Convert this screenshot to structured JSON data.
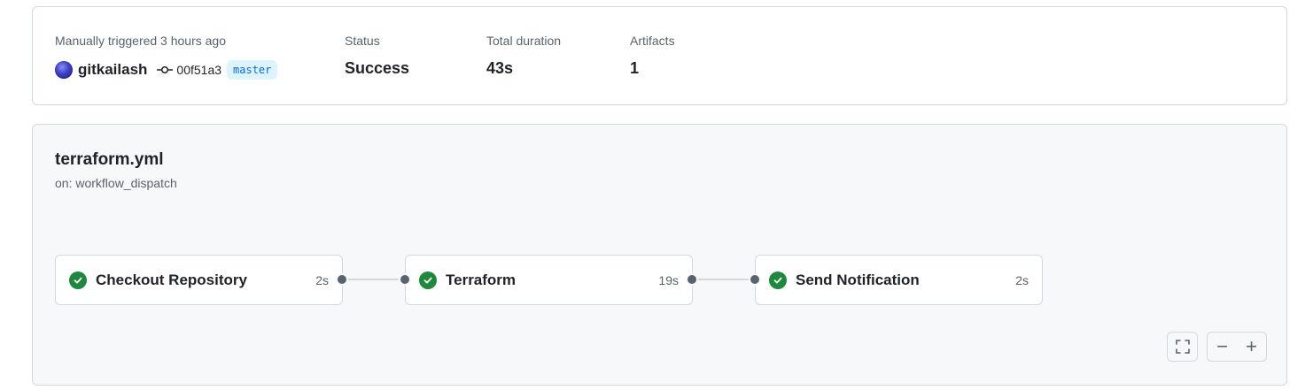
{
  "summary": {
    "trigger_label": "Manually triggered 3 hours ago",
    "actor": "gitkailash",
    "commit_sha": "00f51a3",
    "branch": "master",
    "status_label": "Status",
    "status_value": "Success",
    "duration_label": "Total duration",
    "duration_value": "43s",
    "artifacts_label": "Artifacts",
    "artifacts_value": "1"
  },
  "workflow": {
    "title": "terraform.yml",
    "trigger": "on: workflow_dispatch",
    "jobs": [
      {
        "name": "Checkout Repository",
        "duration": "2s",
        "status": "success"
      },
      {
        "name": "Terraform",
        "duration": "19s",
        "status": "success"
      },
      {
        "name": "Send Notification",
        "duration": "2s",
        "status": "success"
      }
    ]
  },
  "controls": {
    "fullscreen_icon": "fullscreen-icon",
    "zoom_out": "−",
    "zoom_in": "+"
  },
  "colors": {
    "success": "#1f883d",
    "branch_text": "#0969da",
    "branch_bg": "#ddf4ff"
  }
}
